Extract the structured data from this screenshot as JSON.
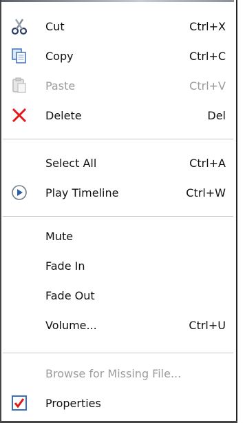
{
  "menu": {
    "items": [
      {
        "label": "Cut",
        "shortcut": "Ctrl+X",
        "icon": "scissors-icon",
        "enabled": true
      },
      {
        "label": "Copy",
        "shortcut": "Ctrl+C",
        "icon": "copy-icon",
        "enabled": true
      },
      {
        "label": "Paste",
        "shortcut": "Ctrl+V",
        "icon": "paste-icon",
        "enabled": false
      },
      {
        "label": "Delete",
        "shortcut": "Del",
        "icon": "delete-x-icon",
        "enabled": true
      },
      {
        "label": "Select All",
        "shortcut": "Ctrl+A",
        "icon": "",
        "enabled": true
      },
      {
        "label": "Play Timeline",
        "shortcut": "Ctrl+W",
        "icon": "play-circle-icon",
        "enabled": true
      },
      {
        "label": "Mute",
        "shortcut": "",
        "icon": "",
        "enabled": true
      },
      {
        "label": "Fade In",
        "shortcut": "",
        "icon": "",
        "enabled": true
      },
      {
        "label": "Fade Out",
        "shortcut": "",
        "icon": "",
        "enabled": true
      },
      {
        "label": "Volume...",
        "shortcut": "Ctrl+U",
        "icon": "",
        "enabled": true
      },
      {
        "label": "Browse for Missing File...",
        "shortcut": "",
        "icon": "",
        "enabled": false
      },
      {
        "label": "Properties",
        "shortcut": "",
        "icon": "checkbox-checked-icon",
        "enabled": true
      }
    ]
  },
  "colors": {
    "delete_red": "#e01818",
    "disabled_text": "#9c9c9c",
    "separator": "#c6c6c6",
    "play_blue": "#2d5ea8"
  }
}
